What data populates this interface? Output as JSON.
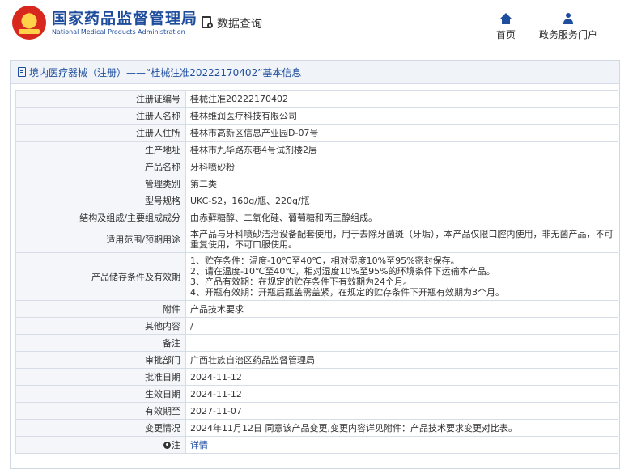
{
  "header": {
    "logo_cn": "国家药品监督管理局",
    "logo_en": "National Medical Products Administration",
    "query_label": "数据查询",
    "nav": {
      "home": "首页",
      "portal": "政务服务门户"
    }
  },
  "panel": {
    "title": "境内医疗器械（注册）——“桂械注准20222170402”基本信息"
  },
  "rows": [
    {
      "label": "注册证编号",
      "value": "桂械注准20222170402"
    },
    {
      "label": "注册人名称",
      "value": "桂林维润医疗科技有限公司"
    },
    {
      "label": "注册人住所",
      "value": "桂林市高新区信息产业园D-07号"
    },
    {
      "label": "生产地址",
      "value": "桂林市九华路东巷4号试剂楼2层"
    },
    {
      "label": "产品名称",
      "value": "牙科喷砂粉"
    },
    {
      "label": "管理类别",
      "value": "第二类"
    },
    {
      "label": "型号规格",
      "value": "UKC-S2，160g/瓶、220g/瓶"
    },
    {
      "label": "结构及组成/主要组成成分",
      "value": "由赤藓糖醇、二氧化硅、葡萄糖和丙三醇组成。"
    },
    {
      "label": "适用范围/预期用途",
      "value": "本产品与牙科喷砂洁治设备配套使用，用于去除牙菌斑（牙垢），本产品仅限口腔内使用，非无菌产品，不可重复使用，不可口服使用。"
    },
    {
      "label": "产品储存条件及有效期",
      "value": "1、贮存条件：温度-10℃至40℃，相对湿度10%至95%密封保存。\n2、请在温度-10℃至40℃，相对湿度10%至95%的环境条件下运输本产品。\n3、产品有效期：在规定的贮存条件下有效期为24个月。\n4、开瓶有效期：开瓶后瓶盖需盖紧，在规定的贮存条件下开瓶有效期为3个月。"
    },
    {
      "label": "附件",
      "value": "产品技术要求"
    },
    {
      "label": "其他内容",
      "value": "/"
    },
    {
      "label": "备注",
      "value": ""
    },
    {
      "label": "审批部门",
      "value": "广西壮族自治区药品监督管理局"
    },
    {
      "label": "批准日期",
      "value": "2024-11-12"
    },
    {
      "label": "生效日期",
      "value": "2024-11-12"
    },
    {
      "label": "有效期至",
      "value": "2027-11-07"
    },
    {
      "label": "变更情况",
      "value": "2024年11月12日 同意该产品变更,变更内容详见附件：产品技术要求变更对比表。"
    },
    {
      "label": "注",
      "value": "详情"
    }
  ]
}
